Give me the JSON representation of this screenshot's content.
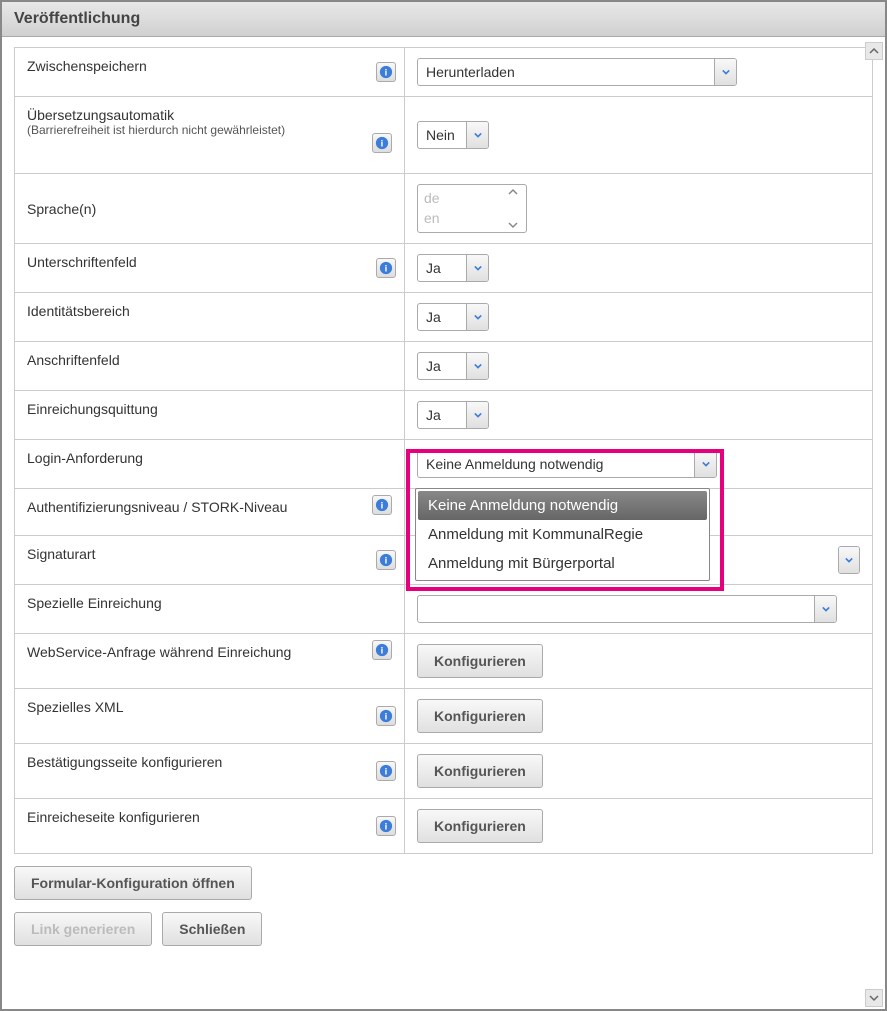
{
  "header": {
    "title": "Veröffentlichung"
  },
  "rows": {
    "zwischenspeichern": {
      "label": "Zwischenspeichern",
      "value": "Herunterladen"
    },
    "uebersetzung": {
      "label": "Übersetzungsautomatik",
      "sublabel": "(Barrierefreiheit ist hierdurch nicht gewährleistet)",
      "value": "Nein"
    },
    "sprachen": {
      "label": "Sprache(n)",
      "options": [
        "de",
        "en"
      ]
    },
    "unterschriftenfeld": {
      "label": "Unterschriftenfeld",
      "value": "Ja"
    },
    "identitaetsbereich": {
      "label": "Identitätsbereich",
      "value": "Ja"
    },
    "anschriftenfeld": {
      "label": "Anschriftenfeld",
      "value": "Ja"
    },
    "einreichungsquittung": {
      "label": "Einreichungsquittung",
      "value": "Ja"
    },
    "login": {
      "label": "Login-Anforderung",
      "value": "Keine Anmeldung notwendig",
      "options": [
        "Keine Anmeldung notwendig",
        "Anmeldung mit KommunalRegie",
        "Anmeldung mit Bürgerportal"
      ]
    },
    "auth": {
      "label": "Authentifizierungsniveau / STORK-Niveau",
      "value": ""
    },
    "signaturart": {
      "label": "Signaturart",
      "value": ""
    },
    "spezielle_einreichung": {
      "label": "Spezielle Einreichung",
      "value": ""
    },
    "webservice": {
      "label": "WebService-Anfrage während Einreichung",
      "button": "Konfigurieren"
    },
    "xml": {
      "label": "Spezielles XML",
      "button": "Konfigurieren"
    },
    "bestaetigung": {
      "label": "Bestätigungsseite konfigurieren",
      "button": "Konfigurieren"
    },
    "einreicheseite": {
      "label": "Einreicheseite konfigurieren",
      "button": "Konfigurieren"
    }
  },
  "footer": {
    "formular_konfig": "Formular-Konfiguration öffnen",
    "link_generieren": "Link generieren",
    "schliessen": "Schließen"
  }
}
